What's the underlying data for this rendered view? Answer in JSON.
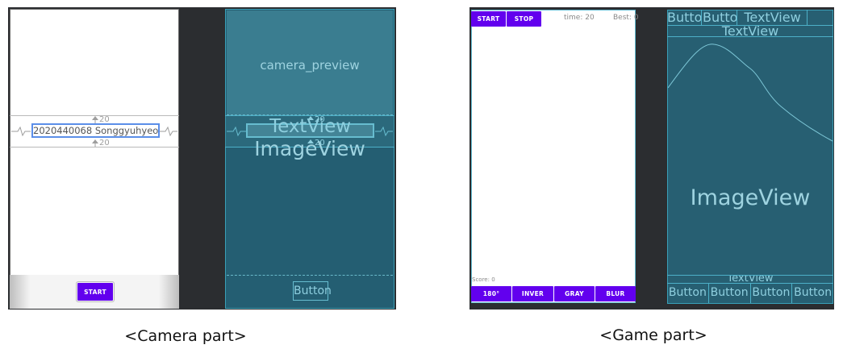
{
  "camera": {
    "textview_text": "2020440068 Songgyuhyeon",
    "margin_top": "20",
    "margin_bottom": "20",
    "start_label": "START",
    "blueprint": {
      "preview_label": "camera_preview",
      "textview_label": "TextView",
      "margin_top": "20",
      "margin_bottom": "20",
      "imageview_label": "ImageView",
      "button_label": "Button"
    },
    "caption": "<Camera part>"
  },
  "game": {
    "start_label": "START",
    "stop_label": "STOP",
    "time_text": "time: 20",
    "best_text": "Best: 0",
    "score_text": "Score: 0",
    "bottom_buttons": [
      "180°",
      "INVER",
      "GRAY",
      "BLUR"
    ],
    "blueprint": {
      "top_buttons": [
        "Button",
        "Button"
      ],
      "top_textview": "TextView",
      "second_textview": "TextView",
      "imageview_label": "ImageView",
      "bottom_textview": "TextView",
      "bottom_buttons": [
        "Button",
        "Button",
        "Button",
        "Button"
      ]
    },
    "caption": "<Game part>"
  },
  "colors": {
    "purple": "#6200ee",
    "blueprint_bg": "#245e72",
    "blueprint_line": "#4db0c8",
    "editor_bg": "#2b2d30"
  }
}
